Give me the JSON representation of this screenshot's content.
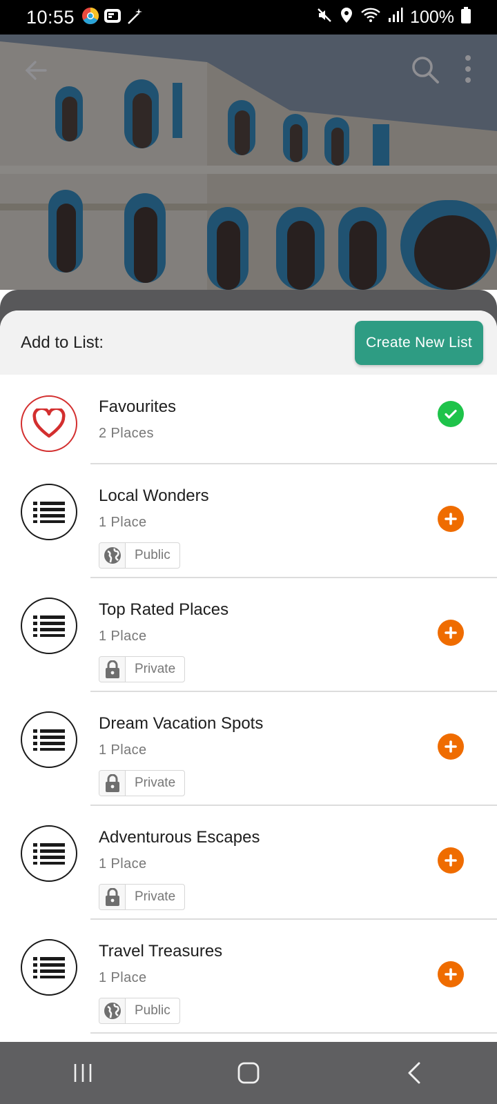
{
  "status_bar": {
    "time": "10:55",
    "battery": "100%",
    "icons": [
      "chrome-like-app-icon",
      "cast-icon",
      "magic-wand-icon",
      "mute-icon",
      "location-icon",
      "wifi-icon",
      "signal-icon",
      "battery-icon"
    ]
  },
  "header": {
    "back_icon": "arrow-left-icon",
    "search_icon": "search-icon",
    "more_icon": "more-vertical-icon"
  },
  "sheet": {
    "title": "Add to List:",
    "create_button": "Create New List"
  },
  "lists": [
    {
      "name": "Favourites",
      "count": "2 Places",
      "icon": "heart-icon",
      "badge": null,
      "state": "added"
    },
    {
      "name": "Local Wonders",
      "count": "1 Place",
      "icon": "list-icon",
      "badge": {
        "label": "Public",
        "icon": "globe-icon"
      },
      "state": "add"
    },
    {
      "name": "Top Rated Places",
      "count": "1 Place",
      "icon": "list-icon",
      "badge": {
        "label": "Private",
        "icon": "lock-icon"
      },
      "state": "add"
    },
    {
      "name": "Dream Vacation Spots",
      "count": "1 Place",
      "icon": "list-icon",
      "badge": {
        "label": "Private",
        "icon": "lock-icon"
      },
      "state": "add"
    },
    {
      "name": "Adventurous Escapes",
      "count": "1 Place",
      "icon": "list-icon",
      "badge": {
        "label": "Private",
        "icon": "lock-icon"
      },
      "state": "add"
    },
    {
      "name": "Travel Treasures",
      "count": "1 Place",
      "icon": "list-icon",
      "badge": {
        "label": "Public",
        "icon": "globe-icon"
      },
      "state": "add"
    }
  ],
  "colors": {
    "accent_button": "#2e9c83",
    "add_action": "#ef6c00",
    "added_action": "#1ec34a",
    "favourite": "#d32f2f"
  },
  "nav_bar": {
    "buttons": [
      "recent-apps-icon",
      "home-icon",
      "back-icon"
    ]
  }
}
